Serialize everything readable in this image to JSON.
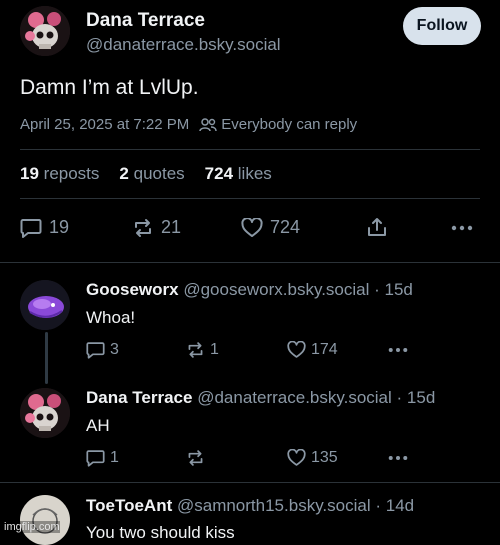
{
  "main_post": {
    "author_name": "Dana Terrace",
    "handle": "@danaterrace.bsky.social",
    "follow_label": "Follow",
    "text": "Damn I’m at LvlUp.",
    "timestamp": "April 25, 2025 at 7:22 PM",
    "reply_setting": "Everybody can reply",
    "stats": {
      "reposts_count": "19",
      "reposts_label": "reposts",
      "quotes_count": "2",
      "quotes_label": "quotes",
      "likes_count": "724",
      "likes_label": "likes"
    },
    "actions": {
      "replies": "19",
      "reposts": "21",
      "likes": "724"
    }
  },
  "replies": [
    {
      "name": "Gooseworx",
      "handle": "@gooseworx.bsky.social",
      "age": "· 15d",
      "text": "Whoa!",
      "reply_count": "3",
      "repost_count": "1",
      "like_count": "174"
    },
    {
      "name": "Dana Terrace",
      "handle": "@danaterrace.bsky.social",
      "age": "· 15d",
      "text": "AH",
      "reply_count": "1",
      "repost_count": "",
      "like_count": "135"
    },
    {
      "name": "ToeToeAnt",
      "handle": "@samnorth15.bsky.social",
      "age": "· 14d",
      "text": "You two should kiss"
    }
  ],
  "watermark": "imgflip.com",
  "colors": {
    "background": "#000000",
    "muted_text": "#8b98a5",
    "follow_button": "#d8e2ec",
    "divider": "#2b3238"
  }
}
